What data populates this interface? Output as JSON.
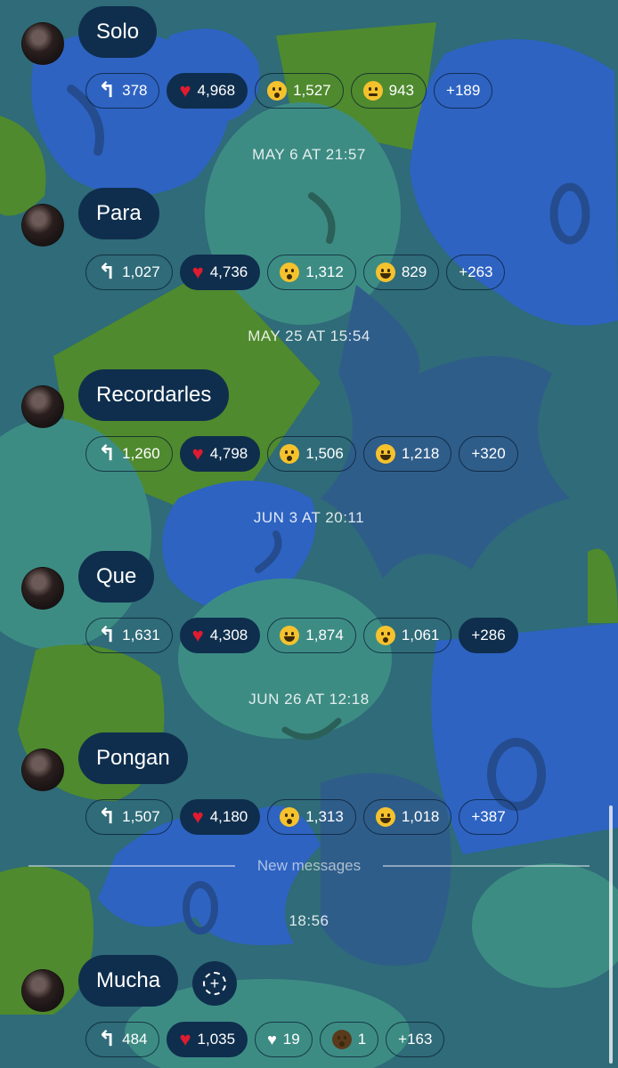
{
  "messages": [
    {
      "text": "Solo",
      "reactions": [
        {
          "type": "reply",
          "count": "378"
        },
        {
          "type": "heart",
          "count": "4,968"
        },
        {
          "type": "wow",
          "count": "1,527"
        },
        {
          "type": "smirk",
          "count": "943"
        },
        {
          "type": "more",
          "count": "+189"
        }
      ]
    },
    {
      "text": "Para",
      "reactions": [
        {
          "type": "reply",
          "count": "1,027"
        },
        {
          "type": "heart",
          "count": "4,736"
        },
        {
          "type": "wow",
          "count": "1,312"
        },
        {
          "type": "laugh",
          "count": "829"
        },
        {
          "type": "more",
          "count": "+263"
        }
      ]
    },
    {
      "text": "Recordarles",
      "reactions": [
        {
          "type": "reply",
          "count": "1,260"
        },
        {
          "type": "heart",
          "count": "4,798"
        },
        {
          "type": "wow",
          "count": "1,506"
        },
        {
          "type": "laugh",
          "count": "1,218"
        },
        {
          "type": "more",
          "count": "+320"
        }
      ]
    },
    {
      "text": "Que",
      "reactions": [
        {
          "type": "reply",
          "count": "1,631"
        },
        {
          "type": "heart",
          "count": "4,308"
        },
        {
          "type": "laugh",
          "count": "1,874"
        },
        {
          "type": "wow",
          "count": "1,061"
        },
        {
          "type": "more",
          "count": "+286"
        }
      ]
    },
    {
      "text": "Pongan",
      "reactions": [
        {
          "type": "reply",
          "count": "1,507"
        },
        {
          "type": "heart",
          "count": "4,180"
        },
        {
          "type": "wow",
          "count": "1,313"
        },
        {
          "type": "laugh",
          "count": "1,018"
        },
        {
          "type": "more",
          "count": "+387"
        }
      ]
    },
    {
      "text": "Mucha",
      "reactions": [
        {
          "type": "reply",
          "count": "484"
        },
        {
          "type": "heart",
          "count": "1,035"
        },
        {
          "type": "white-heart",
          "count": "19"
        },
        {
          "type": "person",
          "count": "1"
        },
        {
          "type": "more",
          "count": "+163"
        }
      ]
    }
  ],
  "dates": [
    "MAY 6 AT 21:57",
    "MAY 25 AT 15:54",
    "JUN 3 AT 20:11",
    "JUN 26 AT 12:18"
  ],
  "new_messages_label": "New messages",
  "time_after_divider": "18:56",
  "colors": {
    "bubble": "#0f2e4d",
    "background": "#2f6b78",
    "heart": "#e01b2f"
  }
}
